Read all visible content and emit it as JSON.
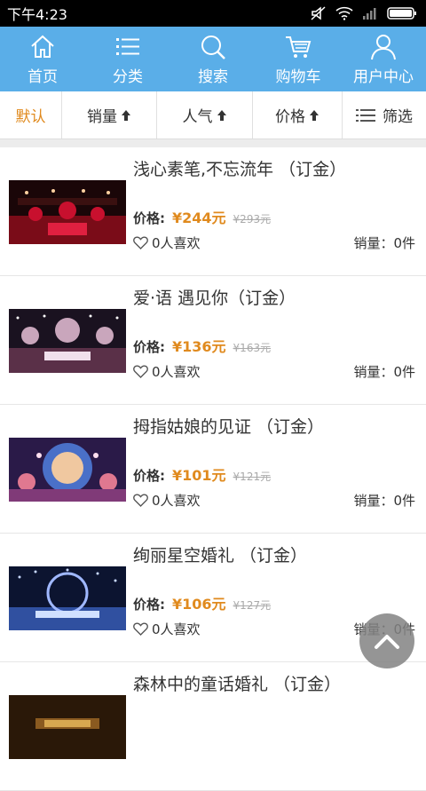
{
  "status": {
    "time": "下午4:23"
  },
  "nav": [
    {
      "label": "首页",
      "icon": "home-icon"
    },
    {
      "label": "分类",
      "icon": "list-icon"
    },
    {
      "label": "搜索",
      "icon": "search-icon"
    },
    {
      "label": "购物车",
      "icon": "cart-icon"
    },
    {
      "label": "用户中心",
      "icon": "user-icon"
    }
  ],
  "sort": {
    "default": "默认",
    "sales": "销量",
    "popularity": "人气",
    "price": "价格",
    "filter": "筛选"
  },
  "colors": {
    "nav_bg": "#5aaee8",
    "accent": "#e08a1e"
  },
  "products": [
    {
      "title": "浅心素笔,不忘流年 （订金）",
      "price_label": "价格:",
      "price": "¥244元",
      "old_price": "¥293元",
      "likes": "0人喜欢",
      "sales": "销量：0件"
    },
    {
      "title": "爱·语 遇见你（订金）",
      "price_label": "价格:",
      "price": "¥136元",
      "old_price": "¥163元",
      "likes": "0人喜欢",
      "sales": "销量：0件"
    },
    {
      "title": "拇指姑娘的见证 （订金）",
      "price_label": "价格:",
      "price": "¥101元",
      "old_price": "¥121元",
      "likes": "0人喜欢",
      "sales": "销量：0件"
    },
    {
      "title": "绚丽星空婚礼 （订金）",
      "price_label": "价格:",
      "price": "¥106元",
      "old_price": "¥127元",
      "likes": "0人喜欢",
      "sales": "销量：0件"
    },
    {
      "title": "森林中的童话婚礼 （订金）",
      "price_label": "价格:",
      "price": "",
      "old_price": "",
      "likes": "",
      "sales": ""
    }
  ]
}
